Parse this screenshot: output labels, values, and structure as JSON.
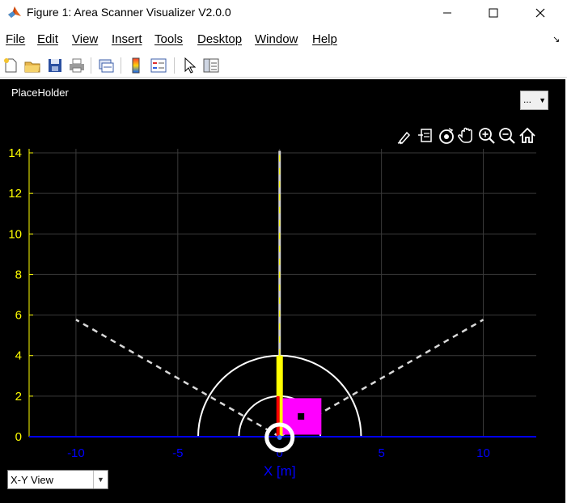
{
  "window": {
    "title": "Figure 1: Area Scanner Visualizer V2.0.0",
    "minimize_glyph": "—",
    "maximize_glyph": "☐",
    "close_glyph": "✕",
    "app_icon": "matlab-icon"
  },
  "menubar": {
    "items": [
      "File",
      "Edit",
      "View",
      "Insert",
      "Tools",
      "Desktop",
      "Window",
      "Help"
    ],
    "dock_arrow": "↘"
  },
  "toolbar": {
    "buttons": [
      "new-figure-icon",
      "open-file-icon",
      "save-icon",
      "print-icon",
      "link-plot-icon",
      "colorbar-icon",
      "legend-icon",
      "pointer-icon",
      "property-inspector-icon"
    ]
  },
  "figure": {
    "placeholder_label": "PlaceHolder",
    "popup_value": "...",
    "axes_toolbar": [
      "brush-icon",
      "data-tips-icon",
      "rotate-icon",
      "pan-icon",
      "zoom-in-icon",
      "zoom-out-icon",
      "home-icon"
    ],
    "view_select": {
      "value": "X-Y View"
    }
  },
  "colors": {
    "background": "#000000",
    "y_ticks": "#ffff00",
    "x_ticks": "#0000ff",
    "grid": "#3a3a3a",
    "range_rings": "#ffffff",
    "fov_lines": "#d9d9d9",
    "beam": "#ffff00",
    "beam_near": "#ff0000",
    "object": "#ff00ff"
  },
  "chart_data": {
    "type": "scatter",
    "xlabel": "X [m]",
    "ylabel": "",
    "xlim": [
      -12.3,
      12.6
    ],
    "ylim": [
      0,
      14.2
    ],
    "x_ticks": [
      -10,
      -5,
      0,
      5,
      10
    ],
    "x_tick_labels": [
      "-10",
      "-5",
      "0",
      "5",
      "10"
    ],
    "y_ticks": [
      0,
      2,
      4,
      6,
      8,
      10,
      12,
      14
    ],
    "y_tick_labels": [
      "0",
      "2",
      "4",
      "6",
      "8",
      "10",
      "12",
      "14"
    ],
    "grid": true,
    "field_of_view_lines": [
      {
        "x": [
          0,
          -10
        ],
        "y": [
          0,
          5.77
        ]
      },
      {
        "x": [
          0,
          10
        ],
        "y": [
          0,
          5.77
        ]
      }
    ],
    "range_rings": [
      2,
      4
    ],
    "beam": {
      "x": 0,
      "y_start": 0,
      "y_end": 14.1
    },
    "beam_segments": [
      {
        "name": "near",
        "y": [
          0,
          2
        ]
      },
      {
        "name": "mid",
        "y": [
          2,
          4
        ]
      },
      {
        "name": "far",
        "y": [
          4,
          14.1
        ]
      }
    ],
    "object": {
      "x": 1.1,
      "y": 1.0,
      "width": 1.9,
      "height": 1.8,
      "marker_x": 1.05,
      "marker_y": 1.0
    },
    "sensor": {
      "x": 0,
      "y": 0
    }
  }
}
